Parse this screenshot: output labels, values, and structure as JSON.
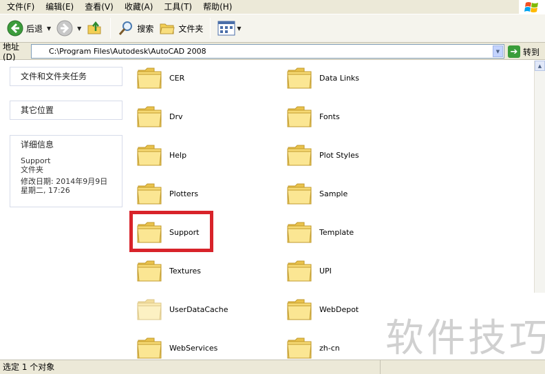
{
  "menu": {
    "items": [
      "文件(F)",
      "编辑(E)",
      "查看(V)",
      "收藏(A)",
      "工具(T)",
      "帮助(H)"
    ]
  },
  "toolbar": {
    "back_label": "后退",
    "search_label": "搜索",
    "folders_label": "文件夹"
  },
  "address": {
    "label": "地址(D)",
    "value": "C:\\Program Files\\Autodesk\\AutoCAD 2008",
    "go_label": "转到"
  },
  "taskpane": {
    "file_tasks_title": "文件和文件夹任务",
    "other_places_title": "其它位置",
    "details_title": "详细信息",
    "details_name": "Support",
    "details_type": "文件夹",
    "details_modified": "修改日期: 2014年9月9日",
    "details_modified_2": "星期二, 17:26"
  },
  "folders": [
    {
      "name": "CER"
    },
    {
      "name": "Data Links"
    },
    {
      "name": "Drv"
    },
    {
      "name": "Fonts"
    },
    {
      "name": "Help"
    },
    {
      "name": "Plot Styles"
    },
    {
      "name": "Plotters"
    },
    {
      "name": "Sample"
    },
    {
      "name": "Support"
    },
    {
      "name": "Template"
    },
    {
      "name": "Textures"
    },
    {
      "name": "UPI"
    },
    {
      "name": "UserDataCache"
    },
    {
      "name": "WebDepot"
    },
    {
      "name": "WebServices"
    },
    {
      "name": "zh-cn"
    }
  ],
  "status": {
    "text": "选定 1 个对象"
  },
  "watermark": "软件技巧",
  "colors": {
    "highlight": "#d8232a",
    "folder": "#f5d66a"
  }
}
